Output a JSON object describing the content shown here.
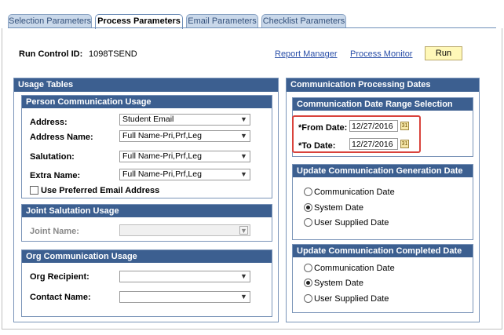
{
  "tabs": [
    {
      "label": "Selection Parameters"
    },
    {
      "label": "Process Parameters"
    },
    {
      "label": "Email Parameters"
    },
    {
      "label": "Checklist Parameters"
    }
  ],
  "header": {
    "run_control_label": "Run Control ID:",
    "run_control_value": "1098TSEND",
    "report_manager": "Report Manager",
    "process_monitor": "Process Monitor",
    "run": "Run"
  },
  "usage_tables": {
    "title": "Usage Tables",
    "person": {
      "title": "Person Communication Usage",
      "address_label": "Address:",
      "address_value": "Student Email",
      "address_name_label": "Address Name:",
      "address_name_value": "Full Name-Pri,Prf,Leg",
      "salutation_label": "Salutation:",
      "salutation_value": "Full Name-Pri,Prf,Leg",
      "extra_name_label": "Extra Name:",
      "extra_name_value": "Full Name-Pri,Prf,Leg",
      "preferred_email_label": "Use Preferred Email Address"
    },
    "joint": {
      "title": "Joint Salutation Usage",
      "joint_name_label": "Joint Name:",
      "joint_name_value": ""
    },
    "org": {
      "title": "Org Communication Usage",
      "org_recipient_label": "Org Recipient:",
      "org_recipient_value": "",
      "contact_name_label": "Contact Name:",
      "contact_name_value": ""
    }
  },
  "processing_dates": {
    "title": "Communication Processing Dates",
    "range": {
      "title": "Communication Date Range Selection",
      "from_label": "*From Date:",
      "from_value": "12/27/2016",
      "to_label": "*To Date:",
      "to_value": "12/27/2016"
    },
    "generation": {
      "title": "Update Communication Generation Date With",
      "options": [
        "Communication Date",
        "System Date",
        "User Supplied Date"
      ],
      "selected": "System Date"
    },
    "completed": {
      "title": "Update Communication Completed Date With",
      "options": [
        "Communication Date",
        "System Date",
        "User Supplied Date"
      ],
      "selected": "System Date"
    }
  },
  "icons": {
    "calendar": "calendar-icon",
    "dropdown": "chevron-down-icon"
  },
  "colors": {
    "group_header": "#3c5f90",
    "highlight": "#d9433c",
    "run_button": "#fff8b8",
    "link": "#2a4fa8"
  }
}
